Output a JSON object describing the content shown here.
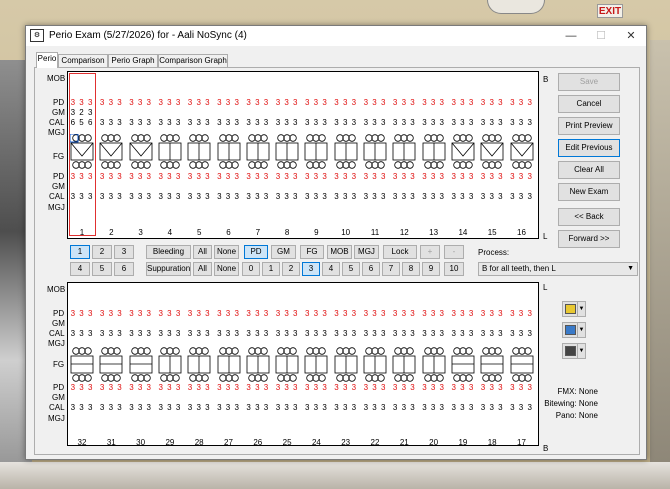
{
  "window": {
    "title": "Perio Exam (5/27/2026) for - Aali NoSync (4)",
    "min": "—",
    "max": "☐",
    "close": "✕"
  },
  "background": {
    "exit_sign": "EXIT"
  },
  "tabs": [
    {
      "label": "Perio",
      "active": true
    },
    {
      "label": "Comparison",
      "active": false
    },
    {
      "label": "Perio Graph",
      "active": false
    },
    {
      "label": "Comparison Graph",
      "active": false
    }
  ],
  "upper": {
    "side_top": "B",
    "side_bottom": "L",
    "labels": {
      "mob": "MOB",
      "pd": "PD",
      "gm": "GM",
      "cal": "CAL",
      "mgj": "MGJ",
      "fg": "FG"
    },
    "teeth": [
      "1",
      "2",
      "3",
      "4",
      "5",
      "6",
      "7",
      "8",
      "9",
      "10",
      "11",
      "12",
      "13",
      "14",
      "15",
      "16"
    ],
    "tooth1_facial": {
      "pd": "3 3 3",
      "gm": "3 2 3",
      "cal": "6 5 6"
    },
    "facial_pd": "3 3 3",
    "facial_cal": "3 3 3",
    "lingual_pd": "3 3 3",
    "lingual_cal": "3 3 3"
  },
  "lower": {
    "side_top": "L",
    "side_bottom": "B",
    "labels": {
      "mob": "MOB",
      "pd": "PD",
      "gm": "GM",
      "cal": "CAL",
      "mgj": "MGJ",
      "fg": "FG"
    },
    "teeth": [
      "32",
      "31",
      "30",
      "29",
      "28",
      "27",
      "26",
      "25",
      "24",
      "23",
      "22",
      "21",
      "20",
      "19",
      "18",
      "17"
    ],
    "lingual_pd": "3 3 3",
    "lingual_cal": "3 3 3",
    "facial_pd": "3 3 3",
    "facial_cal": "3 3 3"
  },
  "toolbar": {
    "row1": [
      "1",
      "2",
      "3",
      "Bleeding",
      "All",
      "None",
      "PD",
      "GM",
      "FG",
      "MOB",
      "MGJ",
      "Lock",
      "+",
      "-"
    ],
    "row2": [
      "4",
      "5",
      "6",
      "Suppuration",
      "All",
      "None",
      "0",
      "1",
      "2",
      "3",
      "4",
      "5",
      "6",
      "7",
      "8",
      "9",
      "10"
    ],
    "selected_row1": [
      "1",
      "PD"
    ],
    "selected_row2": [
      "3"
    ]
  },
  "process": {
    "label": "Process:",
    "value": "B for all teeth, then L"
  },
  "right_buttons": [
    "Save",
    "Cancel",
    "Print Preview",
    "Edit Previous",
    "Clear All",
    "New Exam",
    "<< Back",
    "Forward >>"
  ],
  "info": {
    "fmx": "FMX: None",
    "bitewing": "Bitewing: None",
    "pano": "Pano: None"
  },
  "colors": {
    "measurement_red": "#e01010",
    "selected_blue": "#cce4f7",
    "highlight_red": "#e03030"
  }
}
